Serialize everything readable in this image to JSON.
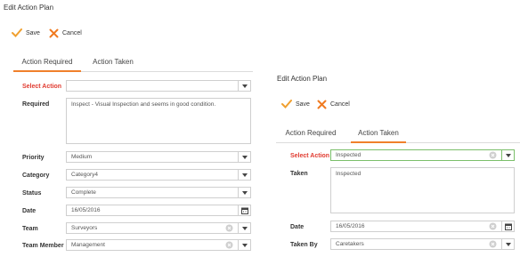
{
  "left_panel": {
    "title": "Edit Action Plan",
    "toolbar": {
      "save_label": "Save",
      "cancel_label": "Cancel"
    },
    "tabs": [
      {
        "label": "Action Required",
        "active": true
      },
      {
        "label": "Action Taken",
        "active": false
      }
    ],
    "fields": {
      "select_action": {
        "label": "Select Action",
        "value": ""
      },
      "required": {
        "label": "Required",
        "value": "Inspect - Visual Inspection and seems in good condition."
      },
      "priority": {
        "label": "Priority",
        "value": "Medium"
      },
      "category": {
        "label": "Category",
        "value": "Category4"
      },
      "status": {
        "label": "Status",
        "value": "Complete"
      },
      "date": {
        "label": "Date",
        "value": "16/05/2016"
      },
      "team": {
        "label": "Team",
        "value": "Surveyors"
      },
      "team_member": {
        "label": "Team Member",
        "value": "Management"
      }
    }
  },
  "right_panel": {
    "title": "Edit Action Plan",
    "toolbar": {
      "save_label": "Save",
      "cancel_label": "Cancel"
    },
    "tabs": [
      {
        "label": "Action Required",
        "active": false
      },
      {
        "label": "Action Taken",
        "active": true
      }
    ],
    "fields": {
      "select_action": {
        "label": "Select Action",
        "value": "Inspected"
      },
      "taken": {
        "label": "Taken",
        "value": "Inspected"
      },
      "date": {
        "label": "Date",
        "value": "16/05/2016"
      },
      "taken_by": {
        "label": "Taken By",
        "value": "Caretakers"
      }
    }
  },
  "colors": {
    "accent": "#f0802b",
    "required_label": "#e03a2f",
    "save_check": "#f0a030",
    "cancel_x": "#f07a20",
    "focus_border": "#7bbf6a"
  },
  "icons": [
    "checkmark-icon",
    "x-icon",
    "chevron-down-icon",
    "clear-icon",
    "calendar-icon"
  ]
}
